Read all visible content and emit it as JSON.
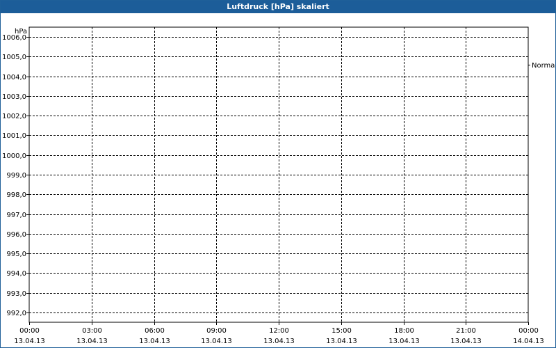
{
  "window": {
    "title": "Luftdruck [hPa] skaliert"
  },
  "chart_data": {
    "type": "line",
    "title": "Luftdruck [hPa] skaliert",
    "ylabel": "hPa",
    "xlabel": "",
    "ylim": [
      991.5,
      1006.5
    ],
    "y_ticks": [
      "992,0",
      "993,0",
      "994,0",
      "995,0",
      "996,0",
      "997,0",
      "998,0",
      "999,0",
      "1000,0",
      "1001,0",
      "1002,0",
      "1003,0",
      "1004,0",
      "1005,0",
      "1006,0"
    ],
    "y_tick_values": [
      992,
      993,
      994,
      995,
      996,
      997,
      998,
      999,
      1000,
      1001,
      1002,
      1003,
      1004,
      1005,
      1006
    ],
    "x_ticks": [
      {
        "time": "00:00",
        "date": "13.04.13"
      },
      {
        "time": "03:00",
        "date": "13.04.13"
      },
      {
        "time": "06:00",
        "date": "13.04.13"
      },
      {
        "time": "09:00",
        "date": "13.04.13"
      },
      {
        "time": "12:00",
        "date": "13.04.13"
      },
      {
        "time": "15:00",
        "date": "13.04.13"
      },
      {
        "time": "18:00",
        "date": "13.04.13"
      },
      {
        "time": "21:00",
        "date": "13.04.13"
      },
      {
        "time": "00:00",
        "date": "14.04.13"
      }
    ],
    "grid": true,
    "series": [
      {
        "name": "Normal",
        "values": [],
        "color": "#000000",
        "reference_value": 1004.6
      }
    ]
  }
}
